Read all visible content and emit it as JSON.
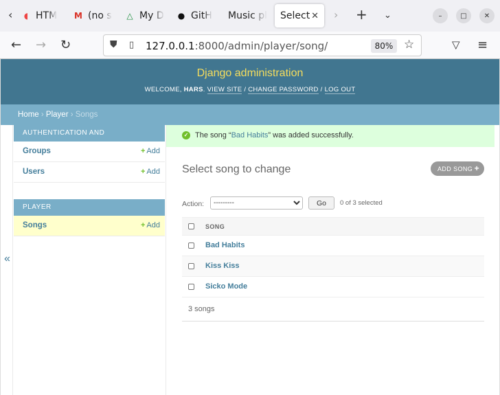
{
  "browser": {
    "tabs": [
      {
        "title": "HTM",
        "icon": "html-icon"
      },
      {
        "title": "(no s",
        "icon": "gmail-icon"
      },
      {
        "title": "My D",
        "icon": "google-drive-icon"
      },
      {
        "title": "GitH",
        "icon": "github-icon"
      },
      {
        "title": "Music pl",
        "icon": ""
      },
      {
        "title": "Select",
        "icon": "",
        "active": true
      }
    ],
    "url_host": "127.0.0.1",
    "url_rest": ":8000/admin/player/song/",
    "zoom": "80%"
  },
  "header": {
    "brand": "Django administration",
    "welcome": "WELCOME, ",
    "username": "HARS",
    "view_site": "VIEW SITE",
    "change_password": "CHANGE PASSWORD",
    "log_out": "LOG OUT"
  },
  "breadcrumbs": {
    "home": "Home",
    "app": "Player",
    "current": "Songs"
  },
  "sidebar": {
    "toggle": "«",
    "modules": [
      {
        "caption": "AUTHENTICATION AND AUTHORIZATION",
        "items": [
          {
            "label": "Groups",
            "add": "Add"
          },
          {
            "label": "Users",
            "add": "Add"
          }
        ]
      },
      {
        "caption": "PLAYER",
        "items": [
          {
            "label": "Songs",
            "add": "Add",
            "current": true
          }
        ]
      }
    ]
  },
  "main": {
    "message_prefix": "The song “",
    "message_link": "Bad Habits",
    "message_suffix": "” was added successfully.",
    "title": "Select song to change",
    "add_button": "ADD SONG",
    "action_label": "Action:",
    "action_select": "---------",
    "go_button": "Go",
    "counter": "0 of 3 selected",
    "column_header": "SONG",
    "rows": [
      "Bad Habits",
      "Kiss Kiss",
      "Sicko Mode"
    ],
    "paginator": "3 songs"
  },
  "colors": {
    "header_bg": "#417690",
    "brand": "#f5dd5d",
    "breadcrumbs_bg": "#79aec8",
    "link": "#447e9b",
    "success_bg": "#ddffdd",
    "add_green": "#70bf2b"
  }
}
